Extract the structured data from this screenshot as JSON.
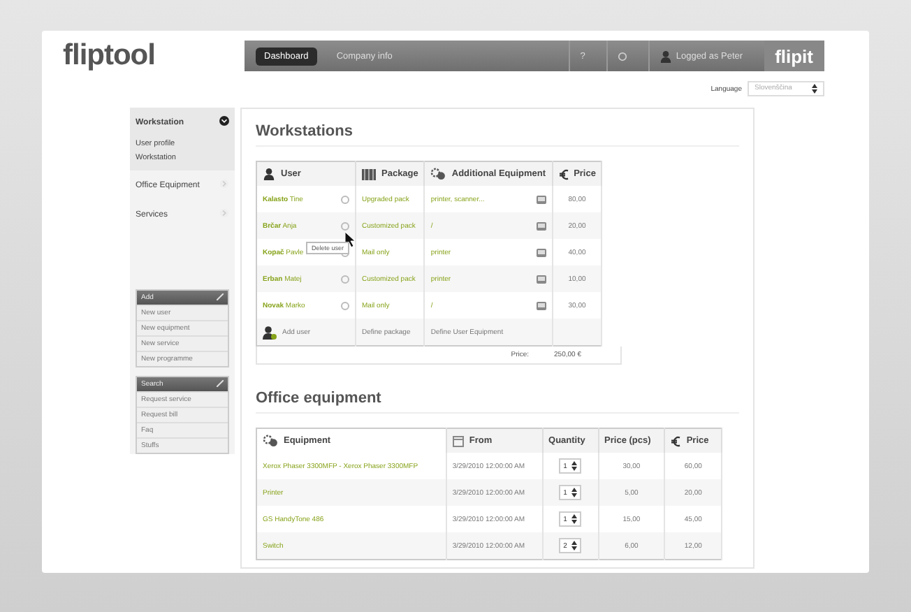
{
  "header": {
    "logo": "fliptool",
    "tabs": [
      {
        "label": "Dashboard",
        "selected": true
      },
      {
        "label": "Company info",
        "selected": false
      }
    ],
    "help": "?",
    "user": "Logged as Peter",
    "brand": "flipit"
  },
  "language": {
    "label": "Language",
    "value": "Slovenščina"
  },
  "sidebar": {
    "sections": [
      {
        "label": "Workstation",
        "expanded": true,
        "children": [
          {
            "label": "User profile"
          },
          {
            "label": "Workstation"
          }
        ]
      },
      {
        "label": "Office Equipment",
        "expanded": false
      },
      {
        "label": "Services",
        "expanded": false
      }
    ],
    "boxes": [
      {
        "title": "Add",
        "items": [
          "New user",
          "New equipment",
          "New service",
          "New programme"
        ]
      },
      {
        "title": "Search",
        "items": [
          "Request service",
          "Request bill",
          "Faq",
          "Stuffs"
        ]
      }
    ]
  },
  "workstations": {
    "title": "Workstations",
    "columns": [
      "User",
      "Package",
      "Additional Equipment",
      "Price"
    ],
    "rows": [
      {
        "surname": "Kalasto",
        "name": "Tine",
        "package": "Upgraded pack",
        "equipment": "printer, scanner...",
        "price": "80,00"
      },
      {
        "surname": "Brčar",
        "name": "Anja",
        "package": "Customized pack",
        "equipment": "/",
        "price": "20,00"
      },
      {
        "surname": "Kopač",
        "name": "Pavle",
        "package": "Mail only",
        "equipment": "printer",
        "price": "40,00"
      },
      {
        "surname": "Erban",
        "name": "Matej",
        "package": "Customized pack",
        "equipment": "printer",
        "price": "10,00"
      },
      {
        "surname": "Novak",
        "name": "Marko",
        "package": "Mail only",
        "equipment": "/",
        "price": "30,00"
      }
    ],
    "actions": [
      "Add user",
      "Define package",
      "Define User Equipment"
    ],
    "total_label": "Price:",
    "total": "250,00 €",
    "tooltip": "Delete user"
  },
  "office_equipment": {
    "title": "Office equipment",
    "columns": [
      "Equipment",
      "From",
      "Quantity",
      "Price (pcs)",
      "Price"
    ],
    "rows": [
      {
        "equipment": "Xerox Phaser 3300MFP - Xerox Phaser 3300MFP",
        "from": "3/29/2010 12:00:00 AM",
        "quantity": "1",
        "unit_price": "30,00",
        "price": "60,00"
      },
      {
        "equipment": "Printer",
        "from": "3/29/2010 12:00:00 AM",
        "quantity": "1",
        "unit_price": "5,00",
        "price": "20,00"
      },
      {
        "equipment": "GS HandyTone 486",
        "from": "3/29/2010 12:00:00 AM",
        "quantity": "1",
        "unit_price": "15,00",
        "price": "45,00"
      },
      {
        "equipment": "Switch",
        "from": "3/29/2010 12:00:00 AM",
        "quantity": "2",
        "unit_price": "6,00",
        "price": "12,00"
      }
    ]
  }
}
